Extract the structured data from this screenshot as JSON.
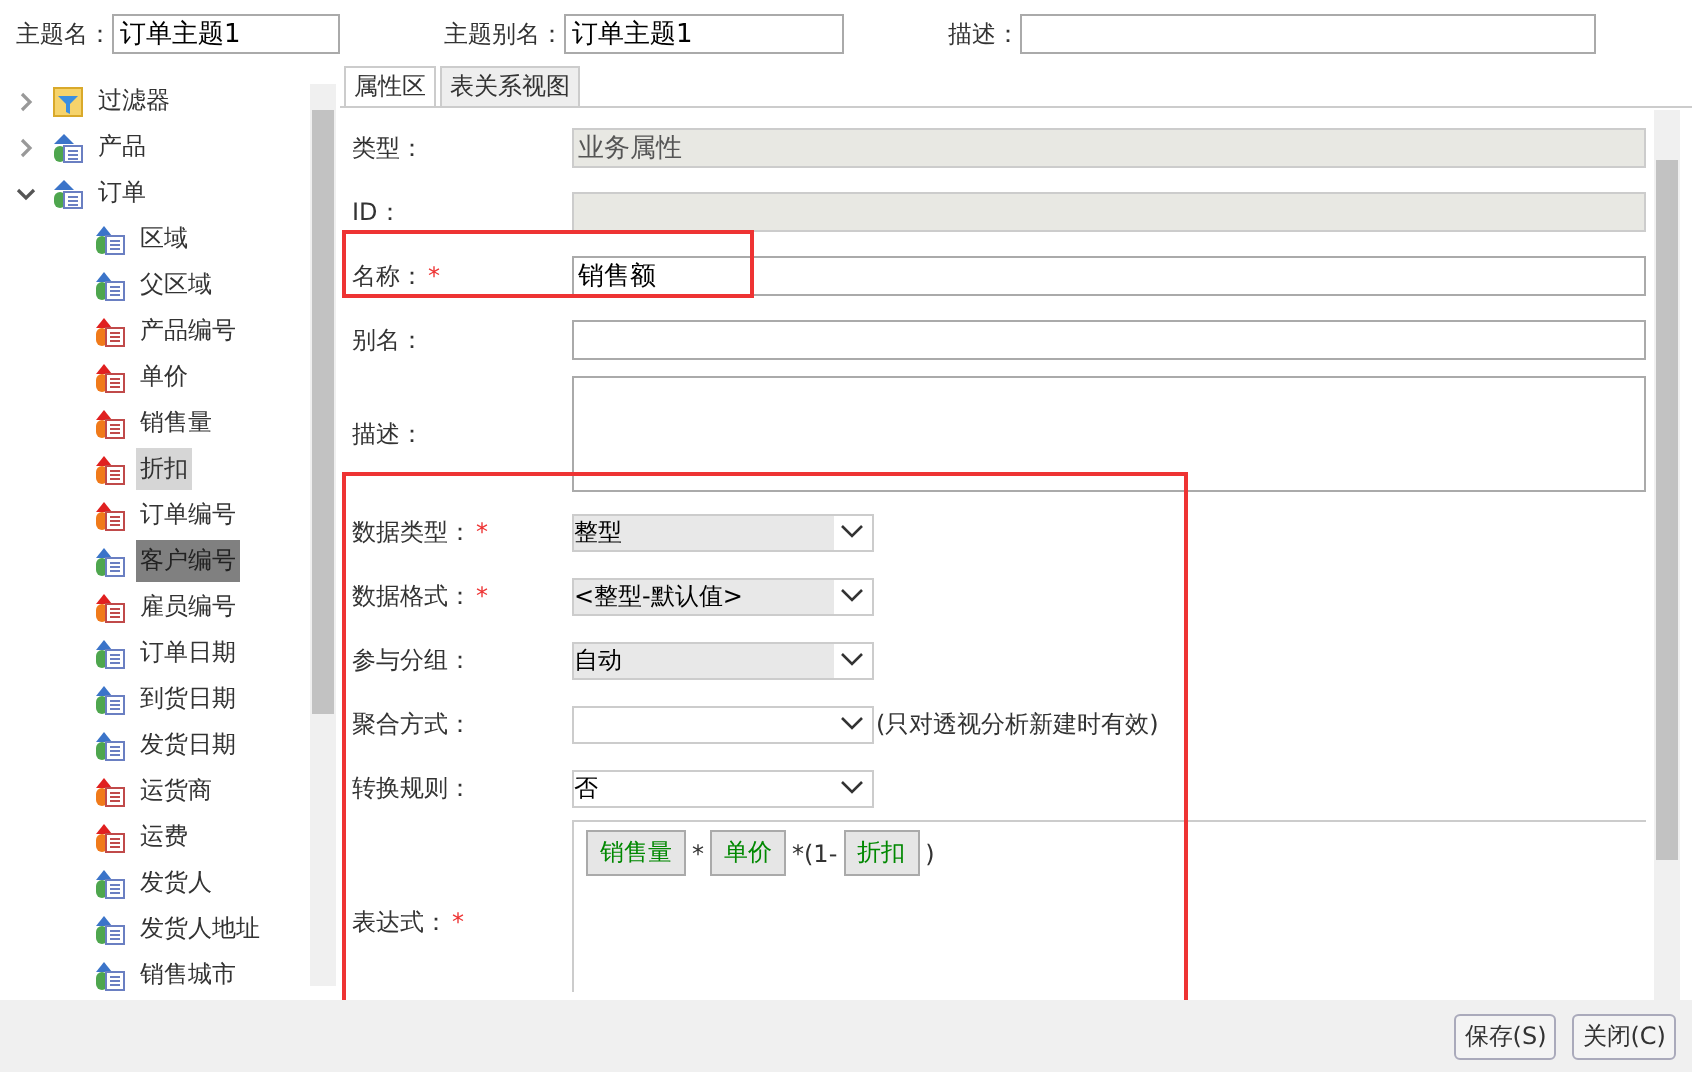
{
  "header": {
    "fields": [
      {
        "label": "主题名：",
        "value": "订单主题1"
      },
      {
        "label": "主题别名：",
        "value": "订单主题1"
      },
      {
        "label": "描述："
      }
    ]
  },
  "tree": {
    "items": [
      {
        "label": "过滤器",
        "kind": "filter",
        "expanded": false,
        "selected": false,
        "hovered": false
      },
      {
        "label": "产品",
        "kind": "table",
        "expanded": false,
        "selected": false,
        "hovered": false
      },
      {
        "label": "订单",
        "kind": "table",
        "expanded": true,
        "selected": false,
        "hovered": false,
        "children": [
          {
            "label": "区域",
            "kind": "dimension",
            "selected": false,
            "hovered": false
          },
          {
            "label": "父区域",
            "kind": "dimension",
            "selected": false,
            "hovered": false
          },
          {
            "label": "产品编号",
            "kind": "measure",
            "selected": false,
            "hovered": false
          },
          {
            "label": "单价",
            "kind": "measure",
            "selected": false,
            "hovered": false
          },
          {
            "label": "销售量",
            "kind": "measure",
            "selected": false,
            "hovered": false
          },
          {
            "label": "折扣",
            "kind": "measure",
            "selected": false,
            "hovered": true
          },
          {
            "label": "订单编号",
            "kind": "measure",
            "selected": false,
            "hovered": false
          },
          {
            "label": "客户编号",
            "kind": "dimension",
            "selected": true,
            "hovered": false
          },
          {
            "label": "雇员编号",
            "kind": "measure",
            "selected": false,
            "hovered": false
          },
          {
            "label": "订单日期",
            "kind": "dimension",
            "selected": false,
            "hovered": false
          },
          {
            "label": "到货日期",
            "kind": "dimension",
            "selected": false,
            "hovered": false
          },
          {
            "label": "发货日期",
            "kind": "dimension",
            "selected": false,
            "hovered": false
          },
          {
            "label": "运货商",
            "kind": "measure",
            "selected": false,
            "hovered": false
          },
          {
            "label": "运费",
            "kind": "measure",
            "selected": false,
            "hovered": false
          },
          {
            "label": "发货人",
            "kind": "dimension",
            "selected": false,
            "hovered": false
          },
          {
            "label": "发货人地址",
            "kind": "dimension",
            "selected": false,
            "hovered": false
          },
          {
            "label": "销售城市",
            "kind": "dimension",
            "selected": false,
            "hovered": false
          }
        ]
      }
    ]
  },
  "tabs": [
    {
      "label": "属性区",
      "selected": true
    },
    {
      "label": "表关系视图",
      "selected": false
    }
  ],
  "form": {
    "fields": [
      {
        "kind": "input",
        "label": "类型：",
        "value": "业务属性",
        "readonly": true,
        "outlined": false
      },
      {
        "kind": "input",
        "label": "ID：",
        "readonly": true,
        "outlined": false
      },
      {
        "kind": "input",
        "label": "名称：",
        "mark": "*",
        "value": "销售额",
        "readonly": false,
        "outlined": true
      },
      {
        "kind": "input",
        "label": "别名：",
        "readonly": false,
        "outlined": false
      },
      {
        "kind": "textarea",
        "label": "描述：",
        "outlined": false
      }
    ],
    "outlined_group": {
      "fields": [
        {
          "kind": "select",
          "label": "数据类型：",
          "mark": "*",
          "value": "整型",
          "readonly": true
        },
        {
          "kind": "select",
          "label": "数据格式：",
          "mark": "*",
          "value": "<整型-默认值>",
          "readonly": true
        },
        {
          "kind": "select",
          "label": "参与分组：",
          "value": "自动",
          "readonly": true
        },
        {
          "kind": "select",
          "label": "聚合方式：",
          "readonly": false,
          "note": "(只对透视分析新建时有效)"
        },
        {
          "kind": "select",
          "label": "转换规则：",
          "value": "否",
          "readonly": false
        },
        {
          "kind": "expression",
          "label": "表达式：",
          "mark": "*",
          "tokens": [
            {
              "kind": "field",
              "text": "销售量"
            },
            {
              "kind": "text",
              "text": "*"
            },
            {
              "kind": "field",
              "text": "单价"
            },
            {
              "kind": "text",
              "text": "*(1-"
            },
            {
              "kind": "field",
              "text": "折扣"
            },
            {
              "kind": "text",
              "text": ")"
            }
          ]
        }
      ]
    }
  },
  "buttons": [
    {
      "label": "保存(S)"
    },
    {
      "label": "关闭(C)"
    }
  ]
}
